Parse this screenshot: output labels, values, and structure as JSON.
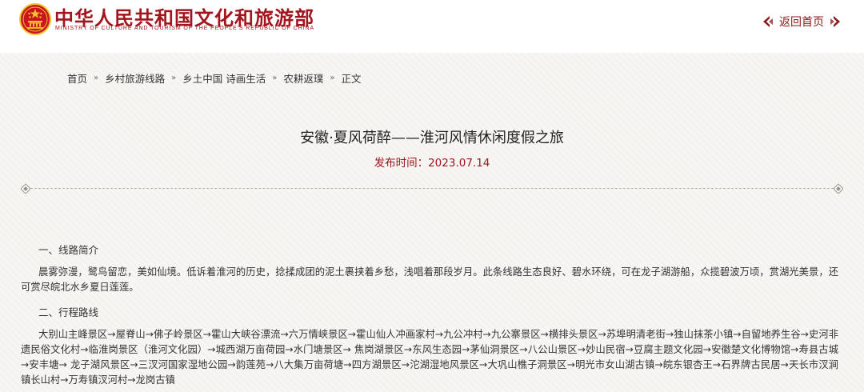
{
  "header": {
    "brand_cn": "中华人民共和国文化和旅游部",
    "brand_en": "MINISTRY OF CULTURE AND TOURISM OF THE PEOPLE'S REPUBLIC OF CHINA",
    "home_link": "返回首页"
  },
  "breadcrumb": {
    "items": [
      "首页",
      "乡村旅游线路",
      "乡土中国 诗画生活",
      "农耕返璞",
      "正文"
    ],
    "separator": "»"
  },
  "article": {
    "title": "安徽·夏风荷醉——淮河风情休闲度假之旅",
    "publish": "发布时间：2023.07.14",
    "section1_head": "一、线路简介",
    "section1_body": "晨雾弥漫，鹭鸟留恋，美如仙境。低诉着淮河的历史，捻揉成团的泥土裹挟着乡愁，浅唱着那段岁月。此条线路生态良好、碧水环绕，可在龙子湖游船，众揽碧波万顷，赏湖光美景，还可赏尽皖北水乡夏日莲莲。",
    "section2_head": "二、行程路线",
    "section2_body": "大别山主峰景区→屋脊山→佛子岭景区→霍山大峡谷漂流→六万情峡景区→霍山仙人冲画家村→九公冲村→九公寨景区→横排头景区→苏埠明清老街→独山抹茶小镇→自留地养生谷→史河非遗民俗文化村→临淮岗景区（淮河文化园）→城西湖万亩荷园→水门塘景区→ 焦岗湖景区→东风生态园→茅仙洞景区→八公山景区→妙山民宿→豆腐主题文化园→安徽楚文化博物馆→寿县古城→安丰塘→ 龙子湖风景区→三汊河国家湿地公园→韵莲苑→八大集万亩荷塘→四方湖景区→沱湖湿地风景区→大巩山樵子洞景区→明光市女山湖古镇→皖东银杏王→石界牌古民居→天长市汊涧镇长山村→万寿镇汊河村→龙岗古镇"
  },
  "colors": {
    "brand_red": "#a3141d",
    "emblem_gold": "#f2c12e"
  },
  "icons": {
    "emblem": "national-emblem-icon",
    "home_left": "ornament-arrow-left-icon",
    "home_right": "ornament-arrow-right-icon",
    "divider_ends": "diamond-icon"
  }
}
